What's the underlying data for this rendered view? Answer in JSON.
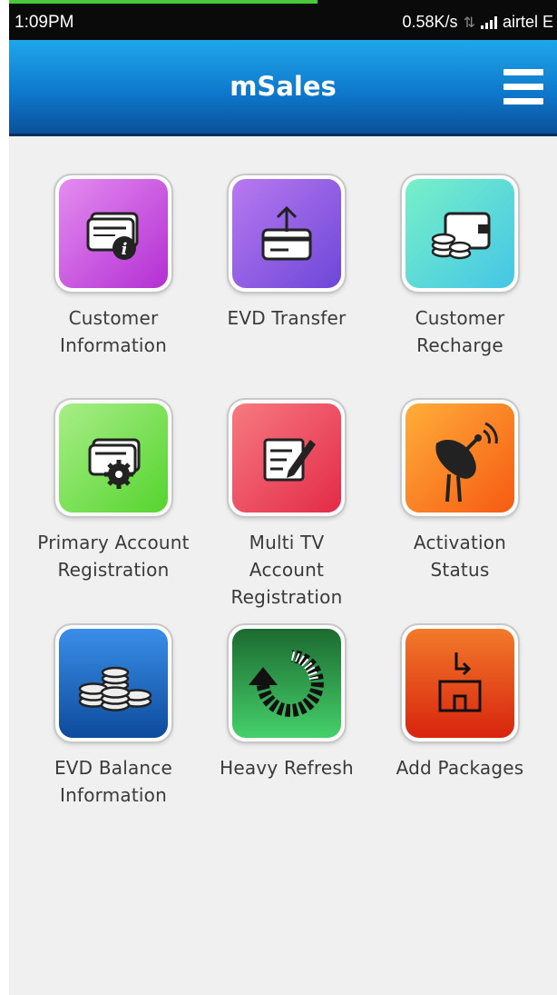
{
  "status_bar": {
    "time": "1:09PM",
    "network_speed": "0.58K/s",
    "carrier": "airtel E"
  },
  "app_bar": {
    "title": "mSales",
    "menu_icon": "hamburger-menu-icon"
  },
  "tiles": [
    {
      "label": "Customer Information",
      "icon": "customer-info-icon",
      "color": "#c54ee0"
    },
    {
      "label": "EVD Transfer",
      "icon": "card-transfer-icon",
      "color": "#8c5be4"
    },
    {
      "label": "Customer Recharge",
      "icon": "coins-recharge-icon",
      "color": "#5ad8d6"
    },
    {
      "label": "Primary Account Registration",
      "icon": "card-gear-icon",
      "color": "#6fdb3f"
    },
    {
      "label": "Multi TV Account Registration",
      "icon": "edit-form-icon",
      "color": "#ee4658"
    },
    {
      "label": "Activation Status",
      "icon": "satellite-dish-icon",
      "color": "#fb7a1c"
    },
    {
      "label": "EVD Balance Information",
      "icon": "coin-stacks-icon",
      "color": "#1f6fc8"
    },
    {
      "label": "Heavy Refresh",
      "icon": "refresh-icon",
      "color": "#2bab4f"
    },
    {
      "label": "Add Packages",
      "icon": "add-package-icon",
      "color": "#e6431a"
    }
  ]
}
